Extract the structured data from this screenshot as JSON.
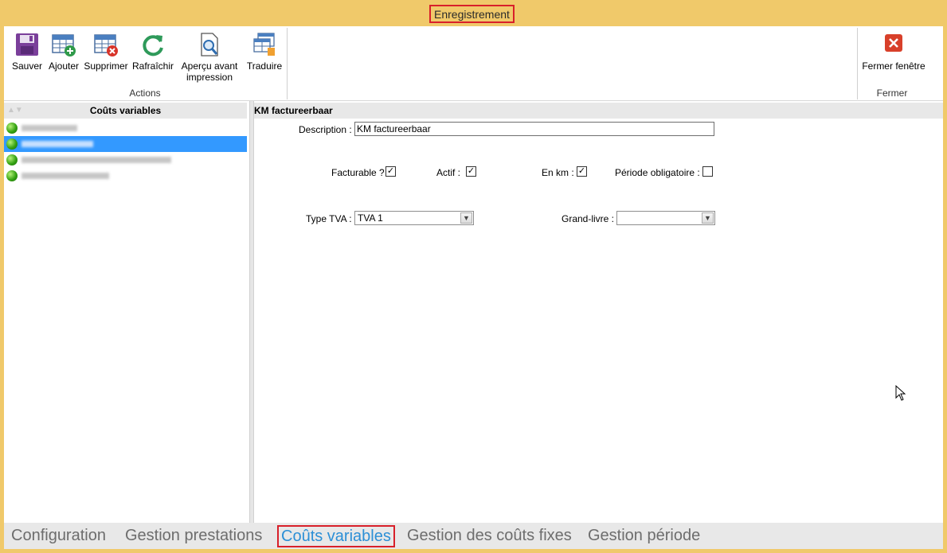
{
  "window": {
    "title": "Enregistrement"
  },
  "ribbon": {
    "actions": [
      {
        "id": "save",
        "label": "Sauver",
        "icon": "save-icon"
      },
      {
        "id": "add",
        "label": "Ajouter",
        "icon": "add-row-icon"
      },
      {
        "id": "delete",
        "label": "Supprimer",
        "icon": "delete-row-icon"
      },
      {
        "id": "refresh",
        "label": "Rafraîchir",
        "icon": "refresh-icon"
      },
      {
        "id": "preview",
        "label": "Aperçu avant\nimpression",
        "icon": "print-preview-icon"
      },
      {
        "id": "translate",
        "label": "Traduire",
        "icon": "translate-icon"
      }
    ],
    "actions_group_label": "Actions",
    "close": {
      "label": "Fermer fenêtre",
      "icon": "close-window-icon"
    },
    "close_group_label": "Fermer"
  },
  "left_panel": {
    "header": "Coûts variables",
    "items_count": 4,
    "selected_index": 1
  },
  "detail": {
    "header": "KM factureerbaar",
    "description_label": "Description :",
    "description_value": "KM factureerbaar",
    "facturable_label": "Facturable ?",
    "facturable_checked": true,
    "actif_label": "Actif :",
    "actif_checked": true,
    "enkm_label": "En km :",
    "enkm_checked": true,
    "periode_label": "Période obligatoire :",
    "periode_checked": false,
    "type_tva_label": "Type TVA :",
    "type_tva_value": "TVA 1",
    "grand_livre_label": "Grand-livre :",
    "grand_livre_value": ""
  },
  "tabs": [
    {
      "label": "Configuration",
      "active": false
    },
    {
      "label": "Gestion prestations",
      "active": false
    },
    {
      "label": "Coûts variables",
      "active": true
    },
    {
      "label": "Gestion des coûts fixes",
      "active": false
    },
    {
      "label": "Gestion période",
      "active": false
    }
  ],
  "colors": {
    "title_bar": "#f0c96a",
    "selection": "#3399ff",
    "active_tab": "#2c8fd6",
    "highlight_border": "#d8202a"
  }
}
